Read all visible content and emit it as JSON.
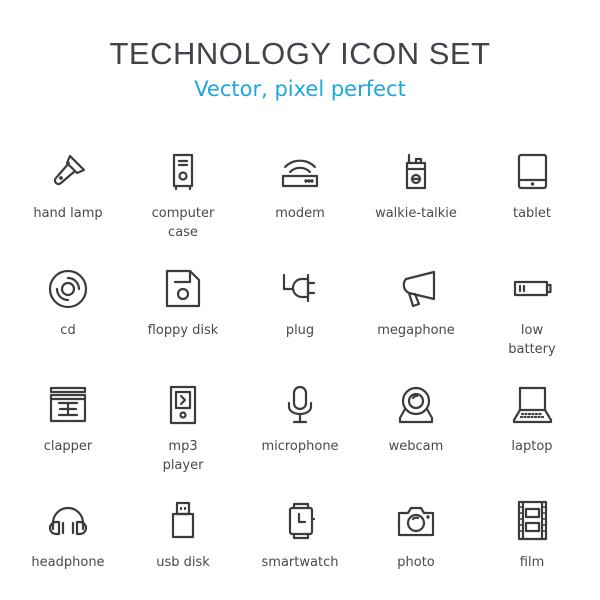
{
  "header": {
    "title": "TECHNOLOGY ICON SET",
    "subtitle": "Vector, pixel perfect"
  },
  "colors": {
    "title": "#41444a",
    "subtitle": "#1ea7dd",
    "icon_stroke": "#3c3c3c",
    "label": "#4a4a4a"
  },
  "icons": [
    {
      "icon": "hand-lamp-icon",
      "label": "hand lamp"
    },
    {
      "icon": "computer-case-icon",
      "label": "computer\ncase"
    },
    {
      "icon": "modem-icon",
      "label": "modem"
    },
    {
      "icon": "walkie-talkie-icon",
      "label": "walkie-talkie"
    },
    {
      "icon": "tablet-icon",
      "label": "tablet"
    },
    {
      "icon": "cd-icon",
      "label": "cd"
    },
    {
      "icon": "floppy-disk-icon",
      "label": "floppy disk"
    },
    {
      "icon": "plug-icon",
      "label": "plug"
    },
    {
      "icon": "megaphone-icon",
      "label": "megaphone"
    },
    {
      "icon": "low-battery-icon",
      "label": "low\nbattery"
    },
    {
      "icon": "clapper-icon",
      "label": "clapper"
    },
    {
      "icon": "mp3-player-icon",
      "label": "mp3\nplayer"
    },
    {
      "icon": "microphone-icon",
      "label": "microphone"
    },
    {
      "icon": "webcam-icon",
      "label": "webcam"
    },
    {
      "icon": "laptop-icon",
      "label": "laptop"
    },
    {
      "icon": "headphone-icon",
      "label": "headphone"
    },
    {
      "icon": "usb-disk-icon",
      "label": "usb disk"
    },
    {
      "icon": "smartwatch-icon",
      "label": "smartwatch"
    },
    {
      "icon": "photo-icon",
      "label": "photo"
    },
    {
      "icon": "film-icon",
      "label": "film"
    }
  ]
}
